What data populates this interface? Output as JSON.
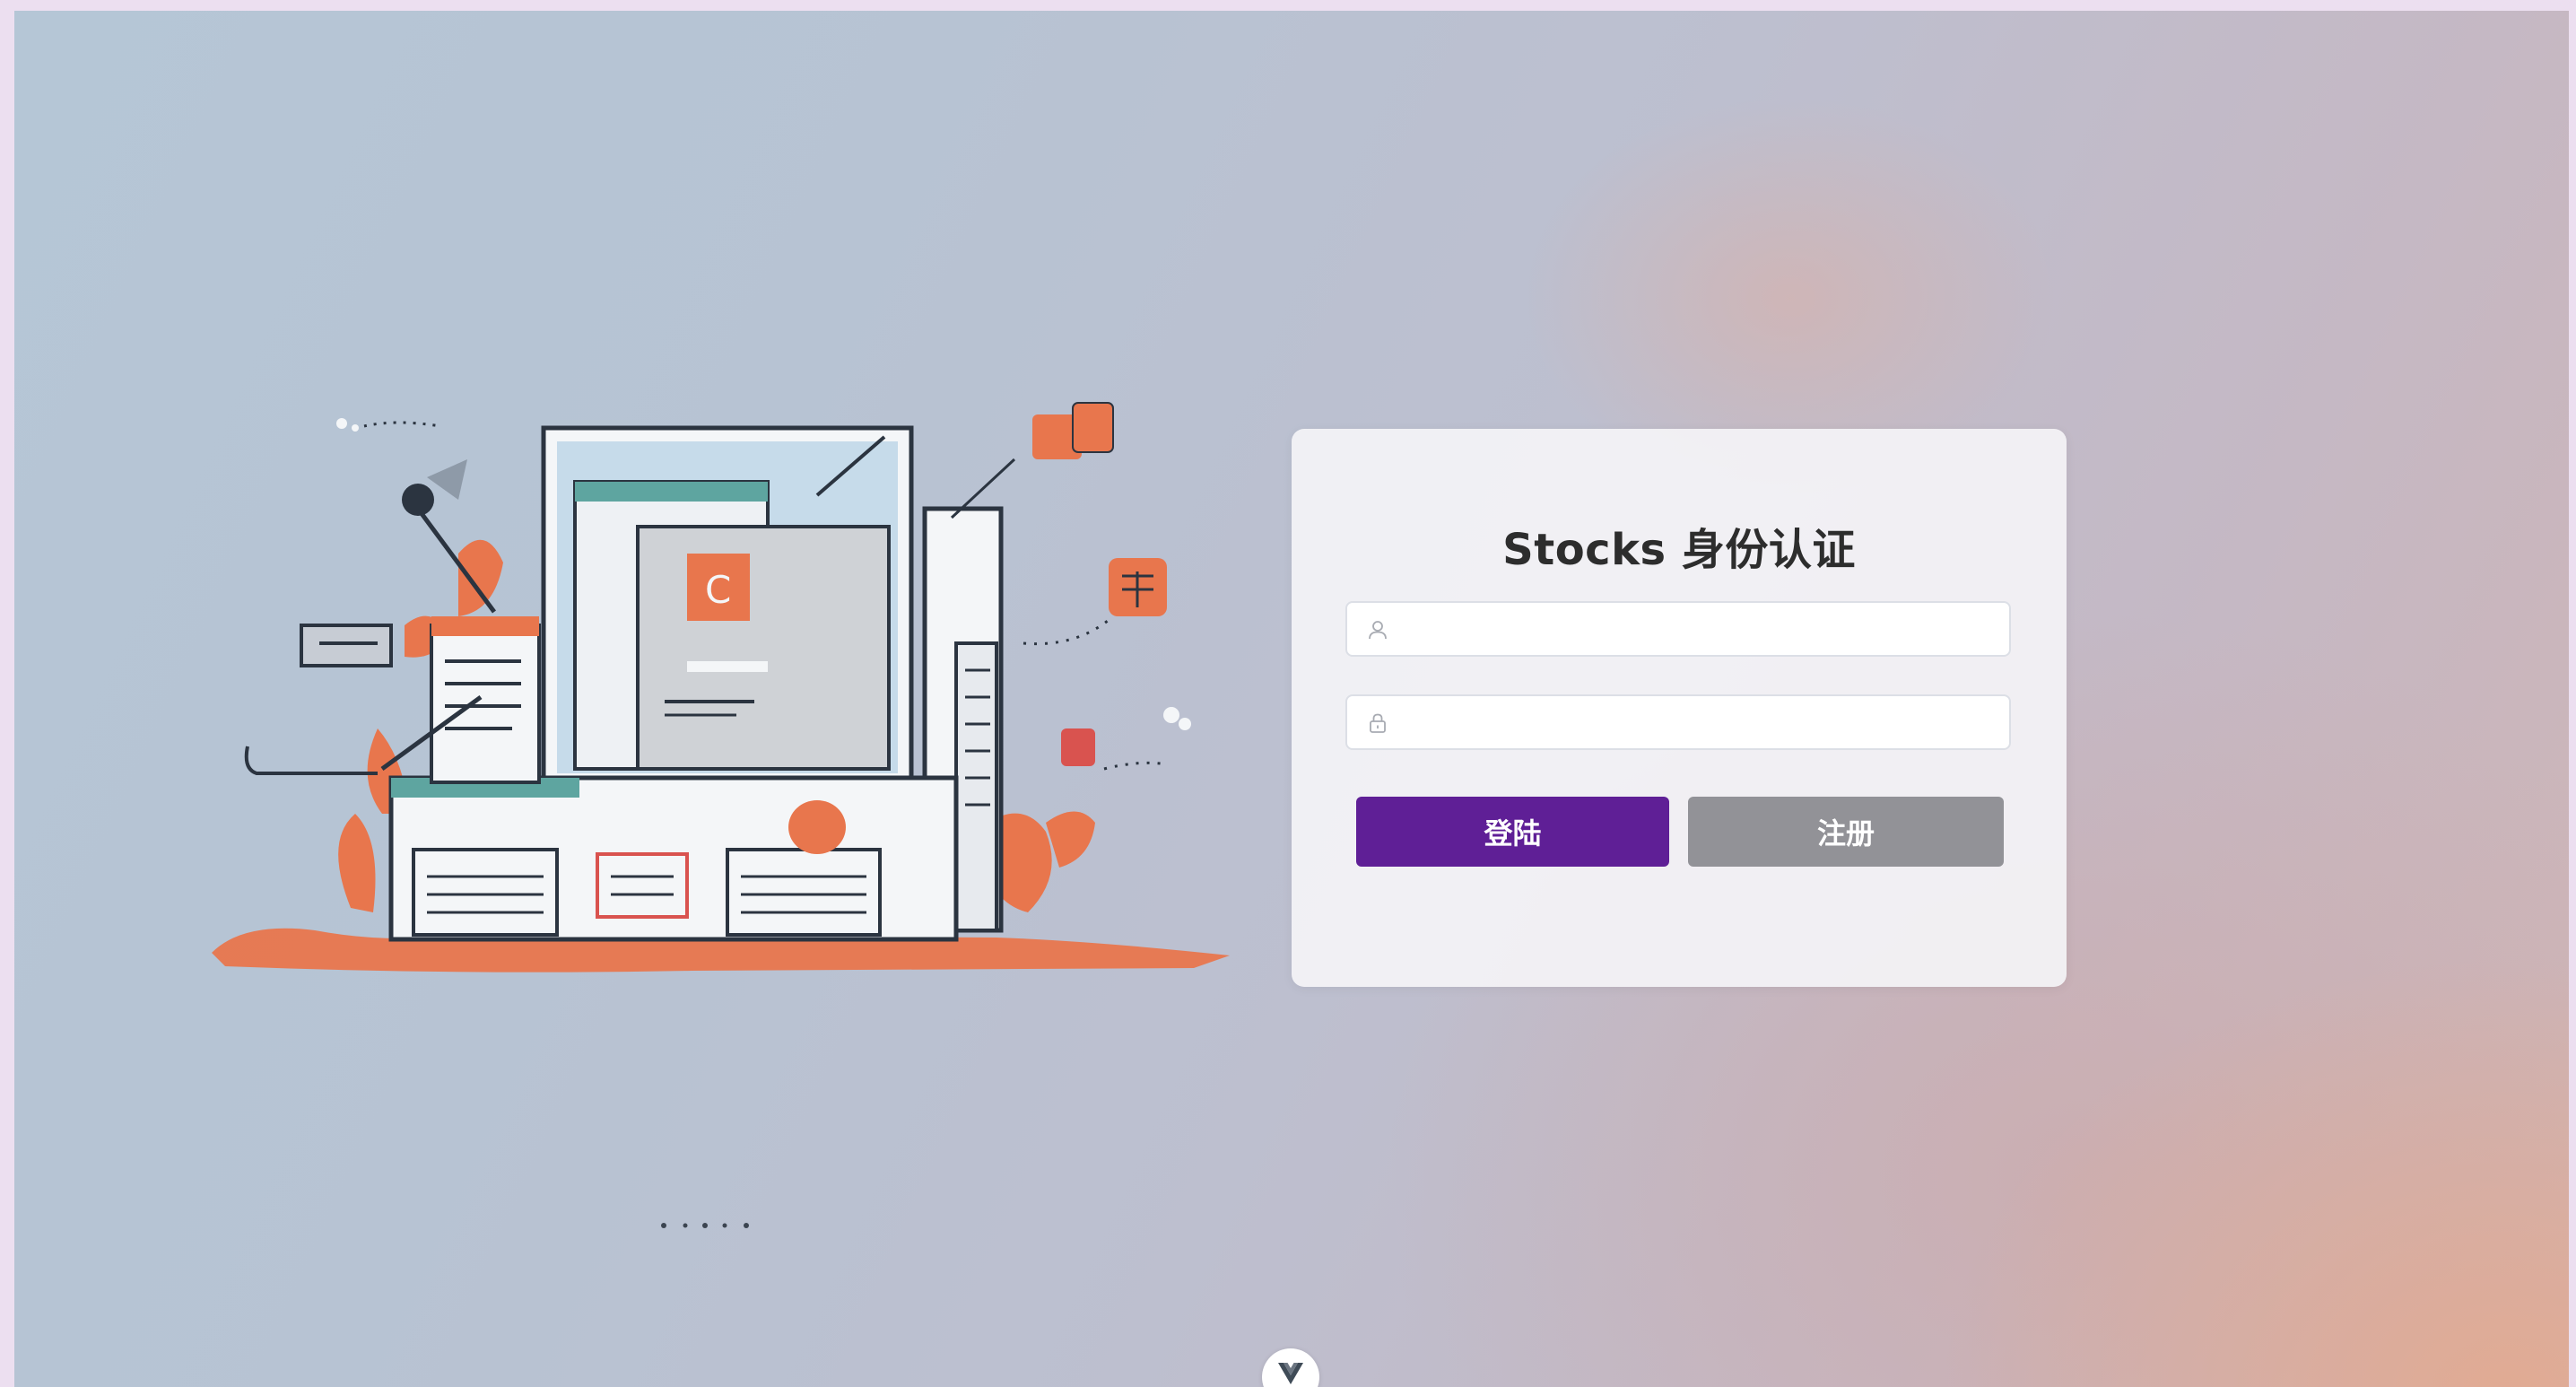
{
  "login": {
    "title": "Stocks 身份认证",
    "username": {
      "value": "",
      "placeholder": "",
      "icon": "user-icon"
    },
    "password": {
      "value": "",
      "placeholder": "",
      "icon": "lock-icon"
    },
    "login_label": "登陆",
    "register_label": "注册"
  },
  "badge": {
    "icon": "vue-logo-icon"
  },
  "colors": {
    "login_button": "#5f1f96",
    "register_button": "#929297",
    "card_background": "#f4f3f6",
    "page_frame": "#ecdff0"
  }
}
